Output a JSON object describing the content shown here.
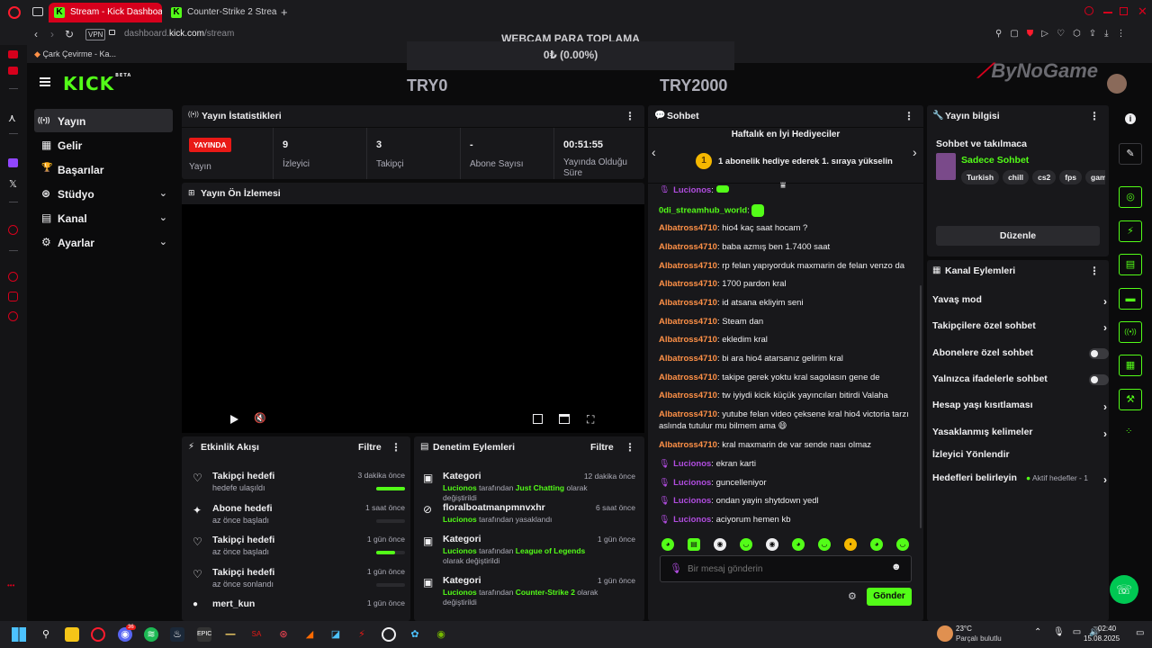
{
  "browser": {
    "tabs": [
      {
        "label": "Stream - Kick Dashboard",
        "active": true
      },
      {
        "label": "Counter-Strike 2 Streamin",
        "active": false
      }
    ],
    "new_tab": "+",
    "vpn": "VPN",
    "url_domain": "dashboard.",
    "url_host": "kick.com",
    "url_path": "/stream",
    "bookmark": "Çark Çevirme - Ka..."
  },
  "overlay": {
    "title": "WEBCAM PARA TOPLAMA",
    "progress_text": "0₺ (0.00%)",
    "progress_fraction": 0,
    "min": "TRY0",
    "max": "TRY2000",
    "watermark": "ByNoGame"
  },
  "kick": {
    "logo": "KICK",
    "beta": "BETA",
    "nav": [
      {
        "label": "Yayın",
        "icon": "((•))",
        "active": true,
        "chevron": false
      },
      {
        "label": "Gelir",
        "icon": "▦",
        "active": false,
        "chevron": false
      },
      {
        "label": "Başarılar",
        "icon": "🏆",
        "active": false,
        "chevron": false
      },
      {
        "label": "Stüdyo",
        "icon": "⊛",
        "active": false,
        "chevron": true
      },
      {
        "label": "Kanal",
        "icon": "▤",
        "active": false,
        "chevron": true
      },
      {
        "label": "Ayarlar",
        "icon": "⚙",
        "active": false,
        "chevron": true
      }
    ]
  },
  "stats": {
    "title": "Yayın İstatistikleri",
    "live_badge": "YAYINDA",
    "live_label": "Yayın",
    "items": [
      {
        "value": "9",
        "label": "İzleyici"
      },
      {
        "value": "3",
        "label": "Takipçi"
      },
      {
        "value": "-",
        "label": "Abone Sayısı"
      },
      {
        "value": "00:51:55",
        "label": "Yayında Olduğu Süre"
      }
    ]
  },
  "preview": {
    "title": "Yayın Ön İzlemesi"
  },
  "activity": {
    "title": "Etkinlik Akışı",
    "filter": "Filtre",
    "rows": [
      {
        "title": "Takipçi hedefi",
        "sub": "hedefe ulaşıldı",
        "time": "3 dakika önce",
        "progress": 1.0,
        "icon": "♡"
      },
      {
        "title": "Abone hedefi",
        "sub": "az önce başladı",
        "time": "1 saat önce",
        "progress": 0,
        "icon": "✦"
      },
      {
        "title": "Takipçi hedefi",
        "sub": "az önce başladı",
        "time": "1 gün önce",
        "progress": 0.67,
        "icon": "♡"
      },
      {
        "title": "Takipçi hedefi",
        "sub": "az önce sonlandı",
        "time": "1 gün önce",
        "progress": 0,
        "icon": "♡"
      },
      {
        "title": "mert_kun",
        "sub": "",
        "time": "1 gün önce",
        "progress": null,
        "icon": "●"
      }
    ]
  },
  "moderation": {
    "title": "Denetim Eylemleri",
    "filter": "Filtre",
    "rows": [
      {
        "title": "Kategori",
        "user": "Lucionos",
        "mid": " tarafından ",
        "target": "Just Chatting",
        "tail": " olarak değiştirildi",
        "time": "12 dakika önce",
        "icon": "▣"
      },
      {
        "title": "floralboatmanpmnvxhr",
        "user": "Lucionos",
        "mid": " tarafından yasaklandı",
        "target": "",
        "tail": "",
        "time": "6 saat önce",
        "icon": "⊘"
      },
      {
        "title": "Kategori",
        "user": "Lucionos",
        "mid": " tarafından ",
        "target": "League of Legends",
        "tail": " olarak değiştirildi",
        "time": "1 gün önce",
        "icon": "▣"
      },
      {
        "title": "Kategori",
        "user": "Lucionos",
        "mid": " tarafından ",
        "target": "Counter-Strike 2",
        "tail": " olarak değiştirildi",
        "time": "1 gün önce",
        "icon": "▣"
      }
    ]
  },
  "chat": {
    "title": "Sohbet",
    "gifters_title": "Haftalık en İyi Hediyeciler",
    "gifters_rank": "1",
    "gifters_msg": "1 abonelik hediye ederek 1. sıraya yükselin",
    "messages": [
      {
        "user": "Lucionos",
        "color": "purple",
        "mic": true,
        "text": ""
      },
      {
        "user": "0di_streamhub_world",
        "color": "green",
        "mic": false,
        "text": ""
      },
      {
        "user": "Albatross4710",
        "color": "orange",
        "mic": false,
        "text": "hio4 kaç saat hocam ?"
      },
      {
        "user": "Albatross4710",
        "color": "orange",
        "mic": false,
        "text": "baba azmış ben 1.7400 saat"
      },
      {
        "user": "Albatross4710",
        "color": "orange",
        "mic": false,
        "text": "rp felan yapıyorduk maxmarin de felan venzo da"
      },
      {
        "user": "Albatross4710",
        "color": "orange",
        "mic": false,
        "text": "1700 pardon kral"
      },
      {
        "user": "Albatross4710",
        "color": "orange",
        "mic": false,
        "text": "id atsana ekliyim seni"
      },
      {
        "user": "Albatross4710",
        "color": "orange",
        "mic": false,
        "text": "Steam dan"
      },
      {
        "user": "Albatross4710",
        "color": "orange",
        "mic": false,
        "text": "ekledim kral"
      },
      {
        "user": "Albatross4710",
        "color": "orange",
        "mic": false,
        "text": "bi ara hio4 atarsanız gelirim kral"
      },
      {
        "user": "Albatross4710",
        "color": "orange",
        "mic": false,
        "text": "takipe gerek yoktu kral sagolasın gene de"
      },
      {
        "user": "Albatross4710",
        "color": "orange",
        "mic": false,
        "text": "tw iyiydi kicik küçük yayıncıları bitirdi Valaha"
      },
      {
        "user": "Albatross4710",
        "color": "orange",
        "mic": false,
        "text": "yutube felan video çeksene kral hio4 victoria tarzı"
      },
      {
        "user": "",
        "color": "orange",
        "mic": false,
        "text": "aslında tutulur mu bilmem ama 😄"
      },
      {
        "user": "Albatross4710",
        "color": "orange",
        "mic": false,
        "text": "kral maxmarin de var sende nası olmaz"
      },
      {
        "user": "Lucionos",
        "color": "purple",
        "mic": true,
        "text": "ekran karti"
      },
      {
        "user": "Lucionos",
        "color": "purple",
        "mic": true,
        "text": "guncelleniyor"
      },
      {
        "user": "Lucionos",
        "color": "purple",
        "mic": true,
        "text": "ondan yayin shytdown yedl"
      },
      {
        "user": "Lucionos",
        "color": "purple",
        "mic": true,
        "text": "aciyorum hemen kb"
      }
    ],
    "input_placeholder": "Bir mesaj gönderin",
    "send": "Gönder"
  },
  "stream_info": {
    "title": "Yayın bilgisi",
    "stream_title": "Sohbet ve takılmaca",
    "category": "Sadece Sohbet",
    "tags": [
      "Turkish",
      "chill",
      "cs2",
      "fps",
      "gam"
    ],
    "edit": "Düzenle"
  },
  "channel_actions": {
    "title": "Kanal Eylemleri",
    "rows": [
      {
        "label": "Yavaş mod",
        "type": "chevron"
      },
      {
        "label": "Takipçilere özel sohbet",
        "type": "chevron"
      },
      {
        "label": "Abonelere özel sohbet",
        "type": "toggle"
      },
      {
        "label": "Yalnızca ifadelerle sohbet",
        "type": "toggle"
      },
      {
        "label": "Hesap yaşı kısıtlaması",
        "type": "chevron"
      },
      {
        "label": "Yasaklanmış kelimeler",
        "type": "chevron"
      },
      {
        "label": "İzleyici Yönlendir",
        "type": "none"
      },
      {
        "label": "Hedefleri belirleyin",
        "type": "chevron",
        "extra": "Aktif hedefler - 1"
      }
    ]
  },
  "taskbar": {
    "weather_temp": "23°C",
    "weather_desc": "Parçalı bulutlu",
    "time": "02:40",
    "date": "15.08.2025",
    "discord_badge": "36"
  }
}
